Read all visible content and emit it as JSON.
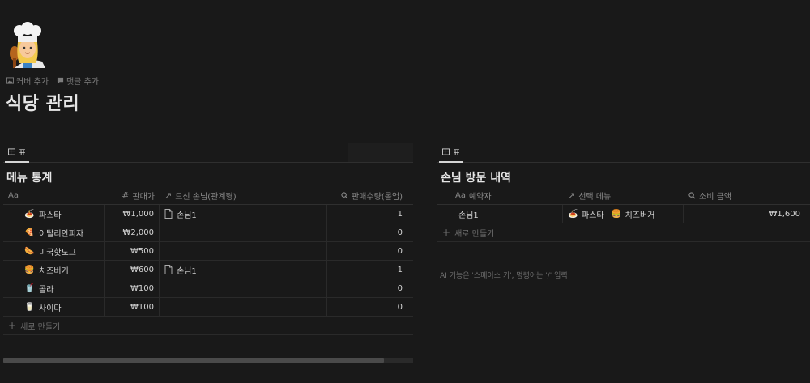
{
  "page": {
    "icon": "cook-emoji",
    "add_cover": "커버 추가",
    "add_comment": "댓글 추가",
    "title": "식당 관리"
  },
  "left_db": {
    "view_label": "표",
    "title": "메뉴 통계",
    "columns": {
      "name": "Aa",
      "price": "판매가",
      "rel": "드신 손님(관계형)",
      "qty": "판매수량(롤업)"
    },
    "rows": [
      {
        "emoji": "🍝",
        "name": "파스타",
        "price": "₩1,000",
        "rel": "손님1",
        "qty": "1"
      },
      {
        "emoji": "🍕",
        "name": "이탈리안피자",
        "price": "₩2,000",
        "rel": "",
        "qty": "0"
      },
      {
        "emoji": "🌭",
        "name": "미국핫도그",
        "price": "₩500",
        "rel": "",
        "qty": "0"
      },
      {
        "emoji": "🍔",
        "name": "치즈버거",
        "price": "₩600",
        "rel": "손님1",
        "qty": "1"
      },
      {
        "emoji": "🥤",
        "name": "콜라",
        "price": "₩100",
        "rel": "",
        "qty": "0"
      },
      {
        "emoji": "🥛",
        "name": "사이다",
        "price": "₩100",
        "rel": "",
        "qty": "0"
      }
    ],
    "new_label": "새로 만들기"
  },
  "right_db": {
    "view_label": "표",
    "title": "손님 방문 내역",
    "columns": {
      "name_prefix": "Aa",
      "name": "예약자",
      "menu": "선택 메뉴",
      "amount": "소비 금액"
    },
    "rows": [
      {
        "name": "손님1",
        "menu1_emoji": "🍝",
        "menu1": "파스타",
        "menu2_emoji": "🍔",
        "menu2": "치즈버거",
        "amount": "₩1,600"
      }
    ],
    "new_label": "새로 만들기",
    "ai_hint": "AI 기능은 '스페이스 키', 명령어는 '/' 입력"
  }
}
